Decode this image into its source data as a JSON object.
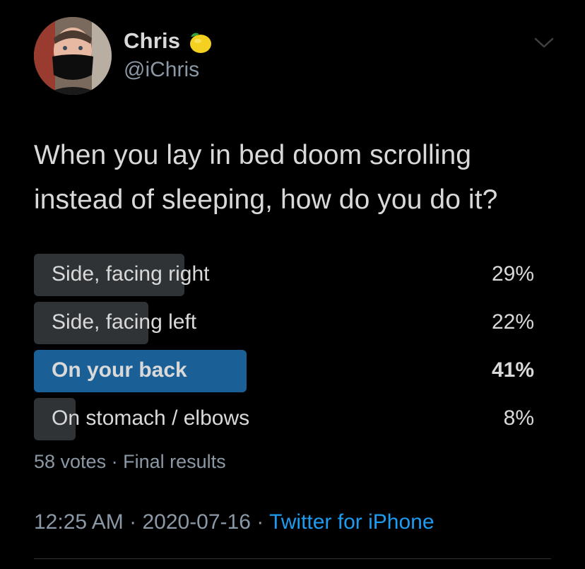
{
  "author": {
    "name": "Chris",
    "name_emoji_icon": "lemon-icon",
    "handle": "@iChris",
    "avatar_icon": "avatar-masked-man"
  },
  "tweet": {
    "text_line1": "When you lay in bed doom scrolling",
    "text_line2": "instead of sleeping, how do you do it?"
  },
  "poll": {
    "options": [
      {
        "label": "Side, facing right",
        "percent": 29,
        "percent_label": "29%",
        "winner": false
      },
      {
        "label": "Side, facing left",
        "percent": 22,
        "percent_label": "22%",
        "winner": false
      },
      {
        "label": "On your back",
        "percent": 41,
        "percent_label": "41%",
        "winner": true
      },
      {
        "label": "On stomach / elbows",
        "percent": 8,
        "percent_label": "8%",
        "winner": false
      }
    ],
    "votes": "58 votes",
    "separator": "·",
    "status": "Final results"
  },
  "footer": {
    "time": "12:25 AM",
    "separator": "·",
    "date": "2020-07-16",
    "source": "Twitter for iPhone"
  },
  "colors": {
    "background": "#000000",
    "text": "#d9d9d9",
    "muted": "#8b98a5",
    "bar": "#2f3336",
    "winner_bar": "#1a5f95",
    "link": "#1d9bf0"
  }
}
